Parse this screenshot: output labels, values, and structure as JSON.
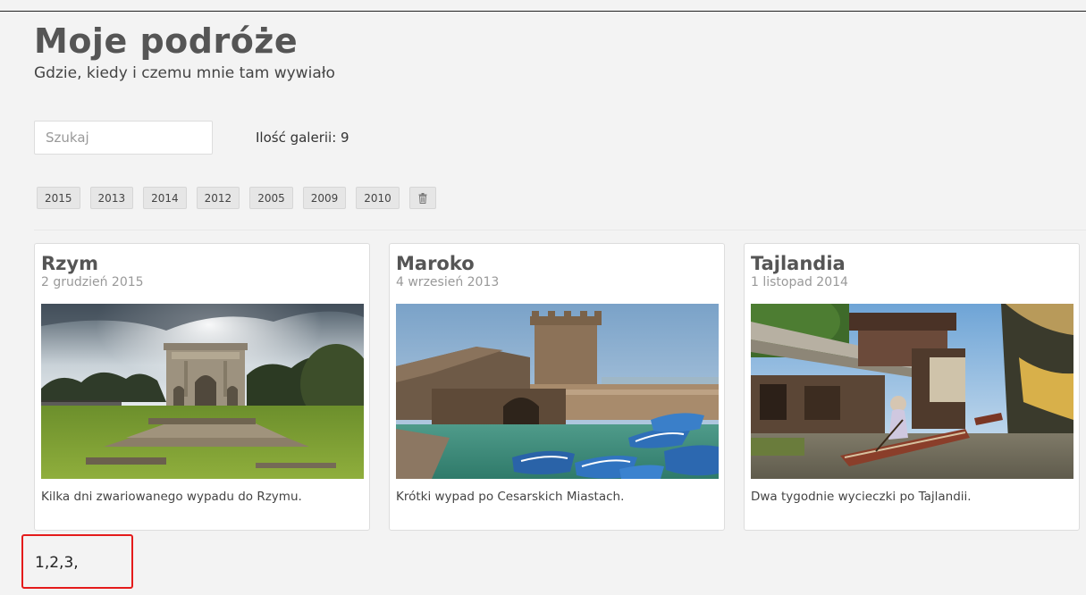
{
  "header": {
    "title": "Moje podróże",
    "subtitle": "Gdzie, kiedy i czemu mnie tam wywiało"
  },
  "search": {
    "placeholder": "Szukaj",
    "value": ""
  },
  "gallery_count": "Ilość galerii: 9",
  "tags": [
    "2015",
    "2013",
    "2014",
    "2012",
    "2005",
    "2009",
    "2010"
  ],
  "tag_trash_icon": "trash-icon",
  "cards": [
    {
      "title": "Rzym",
      "date": "2 grudzień 2015",
      "description": "Kilka dni zwariowanego wypadu do Rzymu.",
      "image": "arch-of-constantine-photo"
    },
    {
      "title": "Maroko",
      "date": "4 wrzesień 2013",
      "description": "Krótki wypad po Cesarskich Miastach.",
      "image": "harbor-fortress-blue-boats-photo"
    },
    {
      "title": "Tajlandia",
      "date": "1 listopad 2014",
      "description": "Dwa tygodnie wycieczki po Tajlandii.",
      "image": "floating-market-photo"
    }
  ],
  "pagination": {
    "text": "1,2,3,",
    "highlight_color": "#e41b1b"
  }
}
